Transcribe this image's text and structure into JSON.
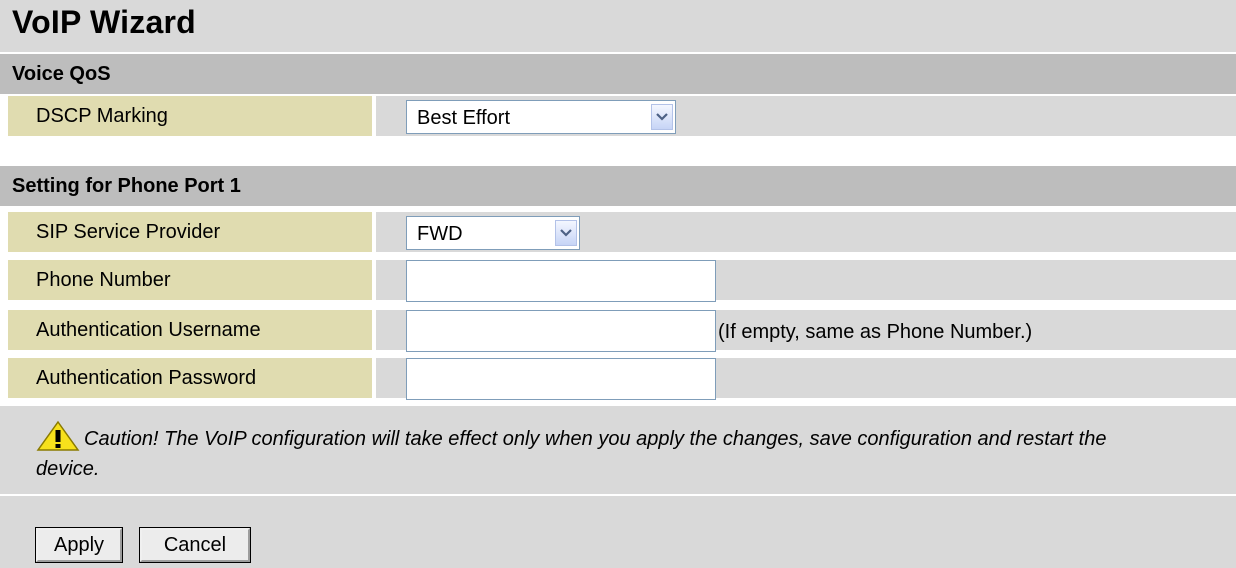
{
  "title": "VoIP Wizard",
  "voice_qos": {
    "header": "Voice QoS",
    "dscp_label": "DSCP Marking",
    "dscp_value": "Best Effort"
  },
  "phone_port": {
    "header": "Setting for Phone Port 1",
    "sip_label": "SIP Service Provider",
    "sip_value": "FWD",
    "phone_label": "Phone Number",
    "phone_value": "",
    "auth_user_label": "Authentication Username",
    "auth_user_value": "",
    "auth_user_hint": "(If empty, same as Phone Number.)",
    "auth_pass_label": "Authentication Password",
    "auth_pass_value": ""
  },
  "caution_text": "Caution! The VoIP configuration will take effect only when you apply the changes, save configuration and restart the device.",
  "buttons": {
    "apply": "Apply",
    "cancel": "Cancel"
  },
  "colors": {
    "title_bg": "#d9d9d9",
    "section_bg": "#bdbdbd",
    "label_bg": "#e0dcb0",
    "value_bg": "#d9d9d9"
  },
  "icons": {
    "caution": "warning-triangle-icon",
    "dropdown": "chevron-down-icon"
  }
}
